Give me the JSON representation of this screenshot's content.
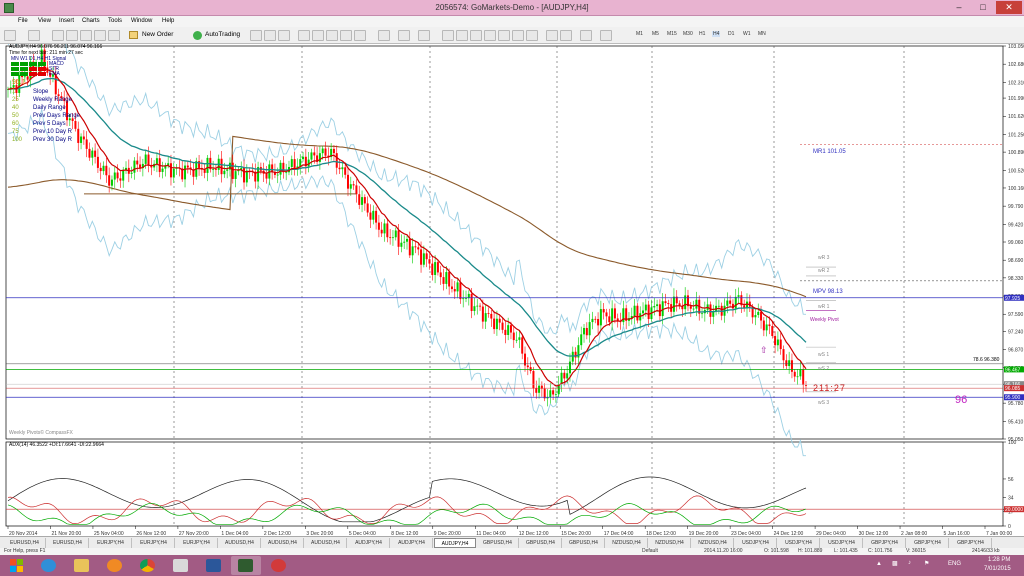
{
  "window": {
    "title": "2056574: GoMarkets-Demo - [AUDJPY,H4]"
  },
  "menu": [
    "File",
    "View",
    "Insert",
    "Charts",
    "Tools",
    "Window",
    "Help"
  ],
  "toolbar": {
    "new_order": "New Order",
    "autotrading": "AutoTrading",
    "timeframes": [
      "M1",
      "M5",
      "M15",
      "M30",
      "H1",
      "H4",
      "D1",
      "W1",
      "MN"
    ]
  },
  "chart": {
    "header": "AUDJPY,H4  96.076 96.211 96.074 96.166",
    "next_bar": "Time for next bar: 211 min 27 sec",
    "signal_panel": {
      "columns": "MN W1 D1 H4 H1  Signal",
      "rows": [
        "MACD",
        "STR",
        "EMA"
      ]
    },
    "legend_numbers": [
      "96.1",
      "1",
      "25",
      "40",
      "50",
      "60",
      "75",
      "100"
    ],
    "legend_labels": [
      "Slope",
      "Weekly Range",
      "Daily Range",
      "Prev Days Range",
      "Prev 5 Days",
      "Prev 10 Day R",
      "Prev 30 Day R"
    ],
    "pivot_labels": {
      "mr1": "MR1  101.05",
      "wr3": "wR 3",
      "wr2": "wR 2",
      "mpv": "MPV  98.13",
      "wr1": "wR 1",
      "weekly_pivot": "Weekly Pivot",
      "ws1": "wS 1",
      "ws2": "wS 2",
      "ws3": "wS 3",
      "fib": "78.6  96.380"
    },
    "countdown": "211:27",
    "big_number": "96",
    "credit": "Weekly Pivots© CompassFX",
    "adx_header": "ADX(14) 46.3522 +DI:17.6641 -DI:22.9664",
    "price_axis": [
      "103.050",
      "102.680",
      "102.310",
      "101.990",
      "101.620",
      "101.250",
      "100.890",
      "100.520",
      "100.160",
      "99.790",
      "99.420",
      "99.060",
      "98.690",
      "98.330",
      "97.960",
      "97.590",
      "97.240",
      "96.870",
      "96.500",
      "96.166",
      "95.780",
      "95.410",
      "95.050"
    ],
    "price_tags": {
      "p1": "97.925",
      "p2": "96.467",
      "p3": "96.166",
      "p4": "96.085",
      "p5": "95.900"
    },
    "adx_axis": [
      "100",
      "56",
      "34",
      "20",
      "17",
      "0"
    ],
    "adx_tag": "20.0000",
    "time_axis": [
      "20 Nov 2014",
      "21 Nov 20:00",
      "25 Nov 04:00",
      "26 Nov 12:00",
      "27 Nov 20:00",
      "1 Dec 04:00",
      "2 Dec 12:00",
      "3 Dec 20:00",
      "5 Dec 04:00",
      "8 Dec 12:00",
      "9 Dec 20:00",
      "11 Dec 04:00",
      "12 Dec 12:00",
      "15 Dec 20:00",
      "17 Dec 04:00",
      "18 Dec 12:00",
      "19 Dec 20:00",
      "23 Dec 04:00",
      "24 Dec 12:00",
      "29 Dec 04:00",
      "30 Dec 12:00",
      "2 Jan 08:00",
      "5 Jan 16:00",
      "7 Jan 00:00"
    ],
    "colors": {
      "price": "#cc0000",
      "ema_fast": "#1a8a8a",
      "ema_slow": "#8b5a2b",
      "bands": "#9dd0e4",
      "bull": "#00cc00",
      "bear": "#ff0000",
      "pivot_blue": "#3030c0",
      "green_level": "#00aa00"
    }
  },
  "tabs": [
    "EURUSD,H4",
    "EURUSD,H4",
    "EURJPY,H4",
    "EURJPY,H4",
    "EURJPY,H4",
    "AUDUSD,H4",
    "AUDUSD,H4",
    "AUDUSD,H4",
    "AUDJPY,H4",
    "AUDJPY,H4",
    "AUDJPY,H4",
    "GBPUSD,H4",
    "GBPUSD,H4",
    "GBPUSD,H4",
    "NZDUSD,H4",
    "NZDUSD,H4",
    "NZDUSD,H4",
    "USDJPY,H4",
    "USDJPY,H4",
    "USDJPY,H4",
    "GBPJPY,H4",
    "GBPJPY,H4",
    "GBPJPY,H4"
  ],
  "active_tab": 10,
  "status": {
    "help": "For Help, press F1",
    "profile": "Default",
    "time": "2014.11.20 16:00",
    "open": "O: 101.598",
    "high": "H: 101.889",
    "low": "L: 101.435",
    "close": "C: 101.756",
    "volume": "V: 36015",
    "traffic": "24146/33 kb"
  },
  "tray": {
    "time": "1:28 PM",
    "date": "7/01/2015",
    "lang": "ENG"
  }
}
